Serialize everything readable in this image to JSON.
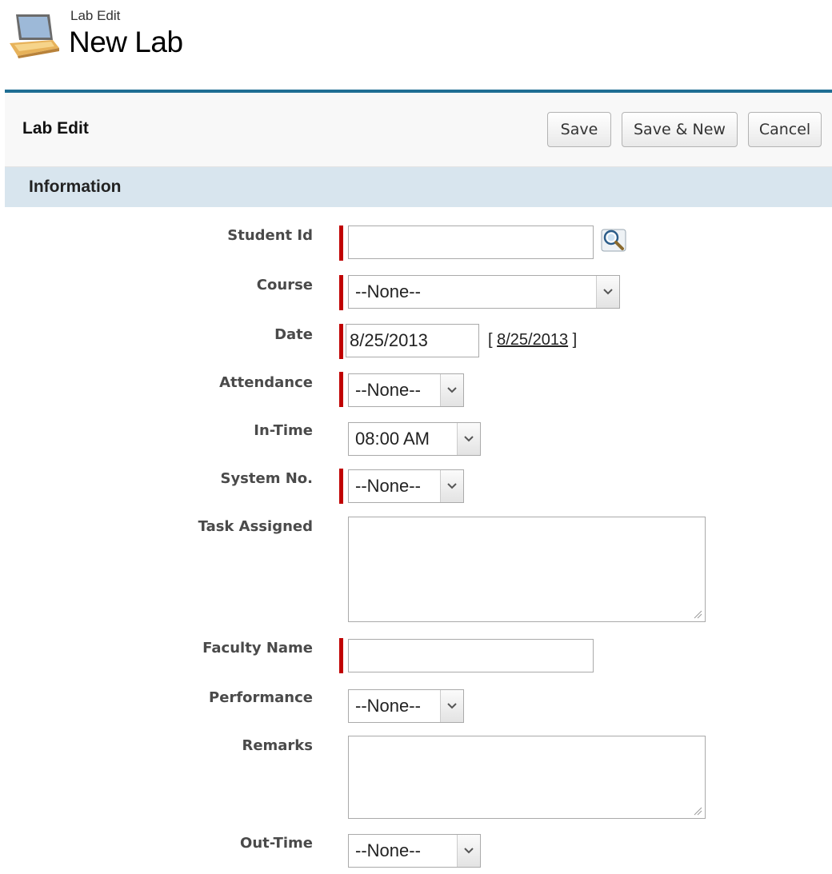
{
  "header": {
    "subtitle": "Lab Edit",
    "title": "New Lab",
    "icon": "laptop-icon"
  },
  "toolbar": {
    "title": "Lab Edit",
    "save_label": "Save",
    "save_new_label": "Save & New",
    "cancel_label": "Cancel"
  },
  "section": {
    "title": "Information",
    "color": "#d8e5ee"
  },
  "accent": {
    "topline": "#1f6e93",
    "required": "#c00000"
  },
  "fields": {
    "student_id": {
      "label": "Student Id",
      "value": "",
      "icon": "lookup-magnifier-icon"
    },
    "course": {
      "label": "Course",
      "value": "--None--"
    },
    "date": {
      "label": "Date",
      "value": "8/25/2013",
      "bracket_open": "[",
      "today_link": "8/25/2013",
      "bracket_close": "]"
    },
    "attendance": {
      "label": "Attendance",
      "value": "--None--"
    },
    "in_time": {
      "label": "In-Time",
      "value": "08:00 AM"
    },
    "system_no": {
      "label": "System No.",
      "value": "--None--"
    },
    "task_assigned": {
      "label": "Task Assigned",
      "value": ""
    },
    "faculty_name": {
      "label": "Faculty Name",
      "value": ""
    },
    "performance": {
      "label": "Performance",
      "value": "--None--"
    },
    "remarks": {
      "label": "Remarks",
      "value": ""
    },
    "out_time": {
      "label": "Out-Time",
      "value": "--None--"
    }
  }
}
